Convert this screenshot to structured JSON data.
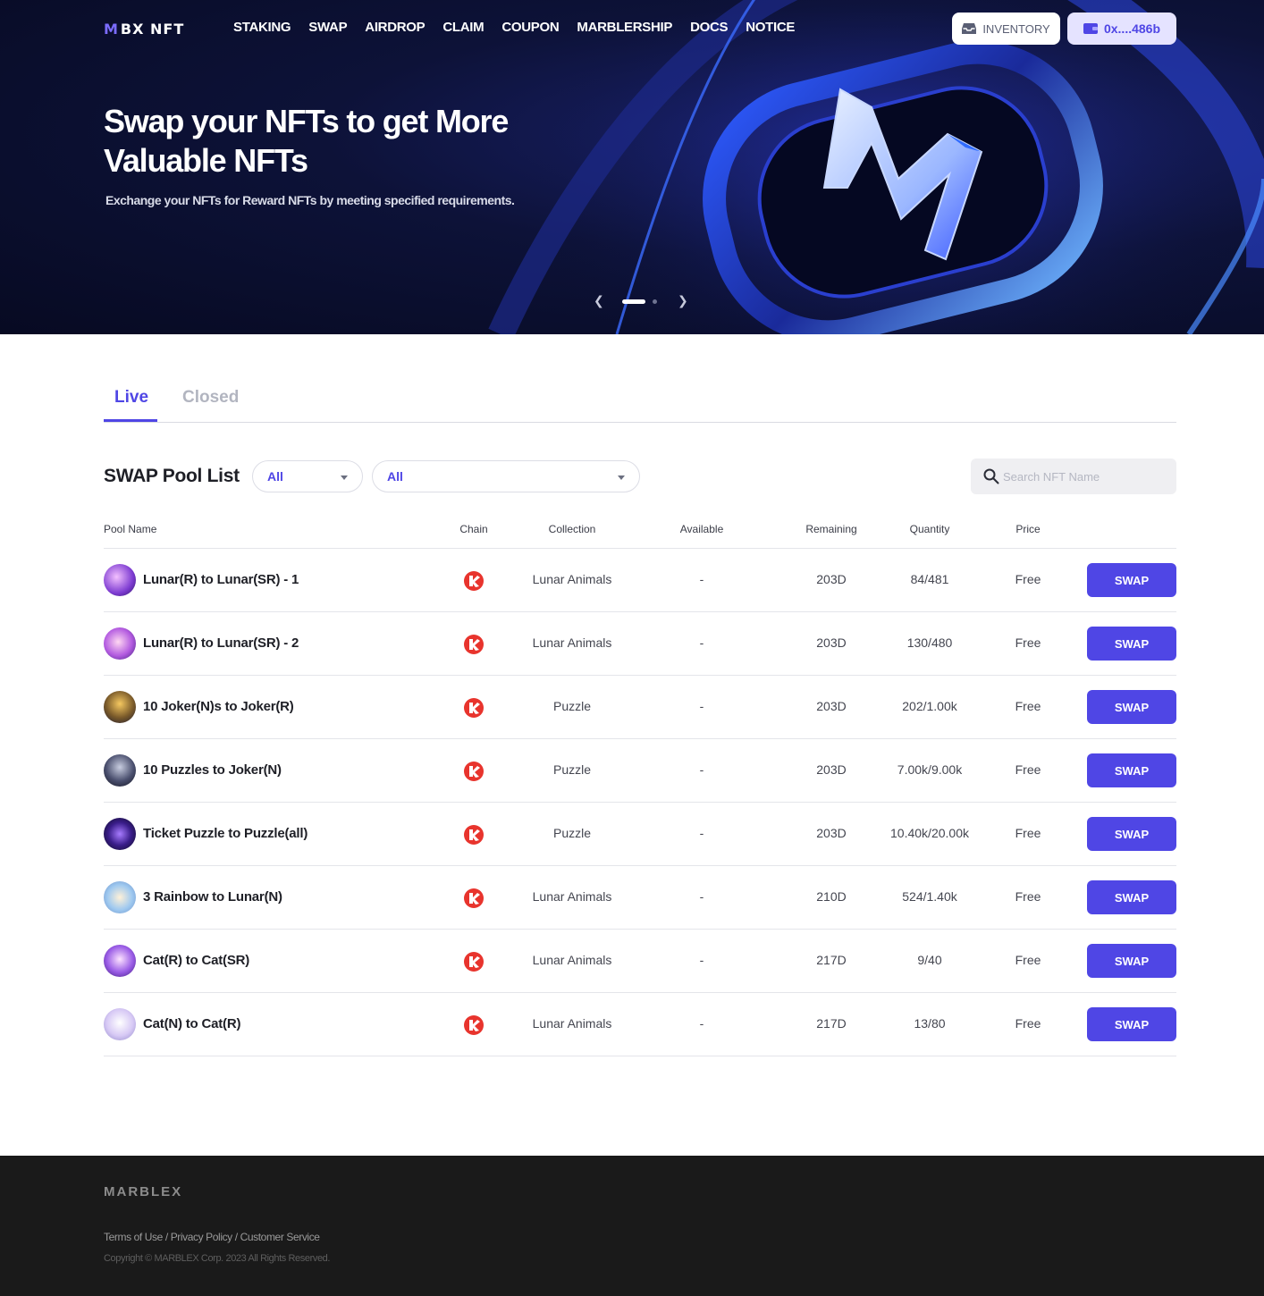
{
  "header": {
    "logo_mark": "M",
    "logo_text": "BX NFT",
    "nav": [
      "STAKING",
      "SWAP",
      "AIRDROP",
      "CLAIM",
      "COUPON",
      "MARBLERSHIP",
      "DOCS",
      "NOTICE"
    ],
    "inventory_label": "INVENTORY",
    "wallet_label": "0x....486b"
  },
  "hero": {
    "title": "Swap your NFTs to get More Valuable NFTs",
    "subtitle": "Exchange your NFTs for Reward NFTs by meeting specified requirements.",
    "slide_count": 2,
    "active_slide": 1
  },
  "tabs": {
    "live": "Live",
    "closed": "Closed",
    "active": "Live"
  },
  "toolbar": {
    "title": "SWAP Pool List",
    "filter_chain": "All",
    "filter_collection": "All",
    "search_placeholder": "Search NFT Name"
  },
  "table": {
    "headers": {
      "pool_name": "Pool Name",
      "chain": "Chain",
      "collection": "Collection",
      "available": "Available",
      "remaining": "Remaining",
      "quantity": "Quantity",
      "price": "Price"
    },
    "swap_label": "SWAP",
    "rows": [
      {
        "name": "Lunar(R) to Lunar(SR) - 1",
        "collection": "Lunar Animals",
        "available": "-",
        "remaining": "203D",
        "quantity": "84/481",
        "price": "Free",
        "avatar": "lunar-purple"
      },
      {
        "name": "Lunar(R) to Lunar(SR) - 2",
        "collection": "Lunar Animals",
        "available": "-",
        "remaining": "203D",
        "quantity": "130/480",
        "price": "Free",
        "avatar": "lunar-purple"
      },
      {
        "name": "10 Joker(N)s to Joker(R)",
        "collection": "Puzzle",
        "available": "-",
        "remaining": "203D",
        "quantity": "202/1.00k",
        "price": "Free",
        "avatar": "joker-gold"
      },
      {
        "name": "10 Puzzles to Joker(N)",
        "collection": "Puzzle",
        "available": "-",
        "remaining": "203D",
        "quantity": "7.00k/9.00k",
        "price": "Free",
        "avatar": "joker-dark"
      },
      {
        "name": "Ticket Puzzle to Puzzle(all)",
        "collection": "Puzzle",
        "available": "-",
        "remaining": "203D",
        "quantity": "10.40k/20.00k",
        "price": "Free",
        "avatar": "ticket-purple"
      },
      {
        "name": "3 Rainbow to Lunar(N)",
        "collection": "Lunar Animals",
        "available": "-",
        "remaining": "210D",
        "quantity": "524/1.40k",
        "price": "Free",
        "avatar": "rainbow-light"
      },
      {
        "name": "Cat(R) to Cat(SR)",
        "collection": "Lunar Animals",
        "available": "-",
        "remaining": "217D",
        "quantity": "9/40",
        "price": "Free",
        "avatar": "cat-purple"
      },
      {
        "name": "Cat(N) to Cat(R)",
        "collection": "Lunar Animals",
        "available": "-",
        "remaining": "217D",
        "quantity": "13/80",
        "price": "Free",
        "avatar": "cat-light"
      }
    ]
  },
  "footer": {
    "logo": "MARBLEX",
    "link_terms": "Terms of Use",
    "link_privacy": "Privacy Policy",
    "link_service": "Customer Service",
    "separator": " / ",
    "copyright": "Copyright © MARBLEX Corp. 2023 All Rights Reserved."
  },
  "colors": {
    "accent": "#4f46e5",
    "hero_bg": "#0d1238",
    "footer_bg": "#1a1a1a",
    "chain_icon": "#e8342d"
  }
}
